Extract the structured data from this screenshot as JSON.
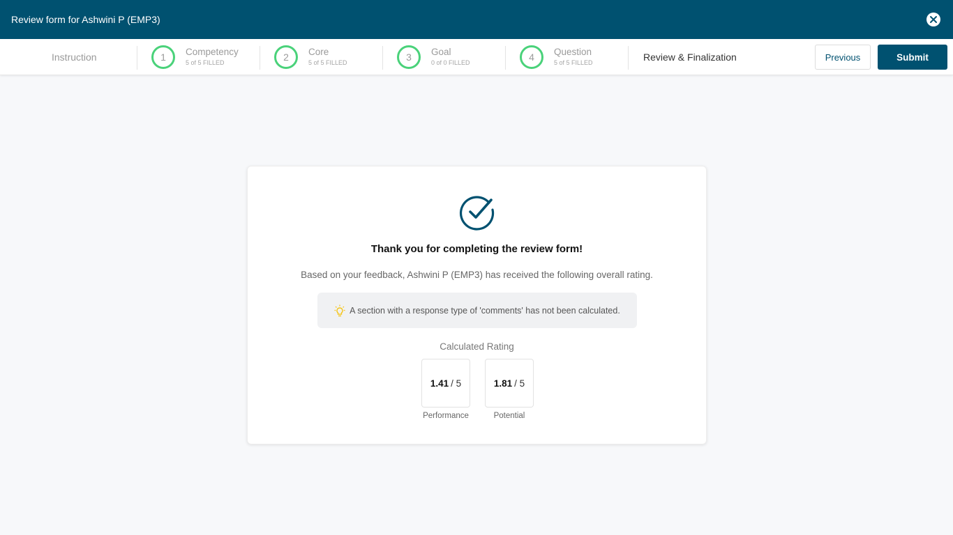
{
  "header": {
    "title": "Review form for Ashwini P (EMP3)",
    "close_icon": "close-circle-icon"
  },
  "steps": {
    "instruction": "Instruction",
    "items": [
      {
        "number": "1",
        "label": "Competency",
        "status": "5 of 5 FILLED"
      },
      {
        "number": "2",
        "label": "Core",
        "status": "5 of 5 FILLED"
      },
      {
        "number": "3",
        "label": "Goal",
        "status": "0 of 0 FILLED"
      },
      {
        "number": "4",
        "label": "Question",
        "status": "5 of 5 FILLED"
      }
    ],
    "active": "Review & Finalization"
  },
  "actions": {
    "previous_label": "Previous",
    "submit_label": "Submit"
  },
  "colors": {
    "brand": "#005170",
    "step_complete": "#4ad27a",
    "bulb": "#f5c518"
  },
  "summary": {
    "icon": "check-circle-icon",
    "title": "Thank you for completing the review form!",
    "description": "Based on your feedback, Ashwini P (EMP3) has received the following overall rating.",
    "note_icon": "lightbulb-icon",
    "note": "A section with a response type of 'comments' has not been calculated.",
    "rating_label": "Calculated Rating",
    "ratings": [
      {
        "value": "1.41",
        "max": "/ 5",
        "caption": "Performance"
      },
      {
        "value": "1.81",
        "max": "/ 5",
        "caption": "Potential"
      }
    ]
  }
}
